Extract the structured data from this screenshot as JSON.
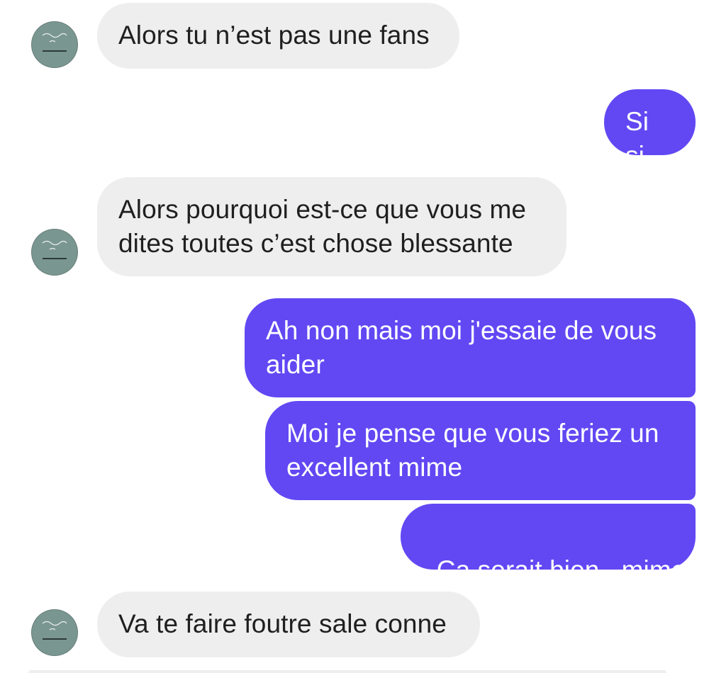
{
  "conversation": {
    "messages": [
      {
        "sender": "contact",
        "text": "Alors tu n’est pas une fans"
      },
      {
        "sender": "me",
        "text": "Si si"
      },
      {
        "sender": "contact",
        "text": "Alors pourquoi est-ce que vous me dites toutes c’est chose blessante"
      },
      {
        "sender": "me",
        "text": "Ah non mais moi j'essaie de vous aider"
      },
      {
        "sender": "me",
        "text": "Moi je pense que vous feriez un excellent mime"
      },
      {
        "sender": "me",
        "text": "Ca serait bien,  mime"
      },
      {
        "sender": "contact",
        "text": "Va te faire foutre sale conne"
      }
    ]
  },
  "colors": {
    "incoming_bubble": "#eeeeee",
    "outgoing_bubble": "#6148f3",
    "avatar_bg": "#7a9690"
  },
  "icons": {
    "avatar": "profile-avatar-icon"
  }
}
